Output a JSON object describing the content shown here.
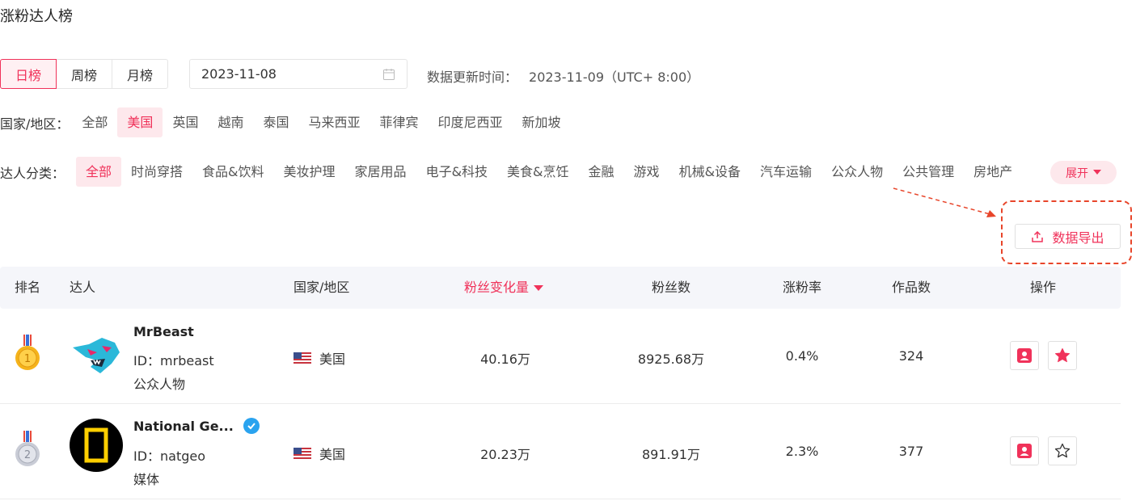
{
  "page": {
    "title": "涨粉达人榜"
  },
  "period_tabs": [
    {
      "label": "日榜",
      "active": true
    },
    {
      "label": "周榜",
      "active": false
    },
    {
      "label": "月榜",
      "active": false
    }
  ],
  "date_picker": {
    "value": "2023-11-08"
  },
  "update_time": {
    "label": "数据更新时间：",
    "value": "2023-11-09（UTC+ 8:00）"
  },
  "country_filter": {
    "label": "国家/地区：",
    "options": [
      "全部",
      "美国",
      "英国",
      "越南",
      "泰国",
      "马来西亚",
      "菲律宾",
      "印度尼西亚",
      "新加坡"
    ],
    "selected": "美国"
  },
  "category_filter": {
    "label": "达人分类：",
    "options": [
      "全部",
      "时尚穿搭",
      "食品&饮料",
      "美妆护理",
      "家居用品",
      "电子&科技",
      "美食&烹饪",
      "金融",
      "游戏",
      "机械&设备",
      "汽车运输",
      "公众人物",
      "公共管理",
      "房地产"
    ],
    "selected": "全部",
    "expand_label": "展开"
  },
  "export": {
    "label": "数据导出"
  },
  "table": {
    "headers": {
      "rank": "排名",
      "creator": "达人",
      "country": "国家/地区",
      "follower_change": "粉丝变化量",
      "followers": "粉丝数",
      "growth_rate": "涨粉率",
      "works": "作品数",
      "actions": "操作"
    },
    "rows": [
      {
        "rank": 1,
        "name": "MrBeast",
        "verified": false,
        "id": "ID：mrbeast",
        "category": "公众人物",
        "country": "美国",
        "follower_change": "40.16万",
        "followers": "8925.68万",
        "growth_rate": "0.4%",
        "works": "324",
        "favorited": true
      },
      {
        "rank": 2,
        "name": "National Ge...",
        "verified": true,
        "id": "ID：natgeo",
        "category": "媒体",
        "country": "美国",
        "follower_change": "20.23万",
        "followers": "891.91万",
        "growth_rate": "2.3%",
        "works": "377",
        "favorited": false
      }
    ]
  },
  "colors": {
    "accent": "#f0325a",
    "accent_bg": "#fde8ec",
    "annotation": "#e8452a",
    "gold": "#f5b31b",
    "silver": "#c9ccd6"
  }
}
